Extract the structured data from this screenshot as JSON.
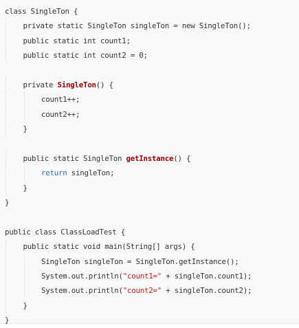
{
  "code_block": {
    "language": "java",
    "colors": {
      "background": "#f6f8fa",
      "text": "#333333",
      "method_name": "#990000",
      "keyword_return": "#2a6fc9",
      "string": "#c41a16"
    },
    "lines": [
      {
        "indent": 0,
        "tokens": [
          {
            "t": "class SingleTon {",
            "k": "plain"
          }
        ]
      },
      {
        "indent": 1,
        "tokens": [
          {
            "t": "private static SingleTon singleTon = new SingleTon();",
            "k": "plain"
          }
        ]
      },
      {
        "indent": 1,
        "tokens": [
          {
            "t": "public static int count1;",
            "k": "plain"
          }
        ]
      },
      {
        "indent": 1,
        "tokens": [
          {
            "t": "public static int count2 = 0;",
            "k": "plain"
          }
        ]
      },
      {
        "indent": 0,
        "tokens": []
      },
      {
        "indent": 1,
        "tokens": [
          {
            "t": "private ",
            "k": "plain"
          },
          {
            "t": "SingleTon",
            "k": "fn"
          },
          {
            "t": "() {",
            "k": "plain"
          }
        ]
      },
      {
        "indent": 2,
        "tokens": [
          {
            "t": "count1++;",
            "k": "plain"
          }
        ]
      },
      {
        "indent": 2,
        "tokens": [
          {
            "t": "count2++;",
            "k": "plain"
          }
        ]
      },
      {
        "indent": 1,
        "tokens": [
          {
            "t": "}",
            "k": "plain"
          }
        ]
      },
      {
        "indent": 0,
        "tokens": []
      },
      {
        "indent": 1,
        "tokens": [
          {
            "t": "public static SingleTon ",
            "k": "plain"
          },
          {
            "t": "getInstance",
            "k": "fn"
          },
          {
            "t": "() {",
            "k": "plain"
          }
        ]
      },
      {
        "indent": 2,
        "tokens": [
          {
            "t": "return",
            "k": "kw"
          },
          {
            "t": " singleTon;",
            "k": "plain"
          }
        ]
      },
      {
        "indent": 1,
        "tokens": [
          {
            "t": "}",
            "k": "plain"
          }
        ]
      },
      {
        "indent": 0,
        "tokens": [
          {
            "t": "}",
            "k": "plain"
          }
        ]
      },
      {
        "indent": 0,
        "tokens": []
      },
      {
        "indent": 0,
        "tokens": [
          {
            "t": "public class ClassLoadTest {",
            "k": "plain"
          }
        ]
      },
      {
        "indent": 1,
        "tokens": [
          {
            "t": "public static void main(String[] args) {",
            "k": "plain"
          }
        ]
      },
      {
        "indent": 2,
        "tokens": [
          {
            "t": "SingleTon singleTon = SingleTon.getInstance();",
            "k": "plain"
          }
        ]
      },
      {
        "indent": 2,
        "tokens": [
          {
            "t": "System.out.println(",
            "k": "plain"
          },
          {
            "t": "\"count1=\"",
            "k": "str"
          },
          {
            "t": " + singleTon.count1);",
            "k": "plain"
          }
        ]
      },
      {
        "indent": 2,
        "tokens": [
          {
            "t": "System.out.println(",
            "k": "plain"
          },
          {
            "t": "\"count2=\"",
            "k": "str"
          },
          {
            "t": " + singleTon.count2);",
            "k": "plain"
          }
        ]
      },
      {
        "indent": 1,
        "tokens": [
          {
            "t": "}",
            "k": "plain"
          }
        ]
      },
      {
        "indent": 0,
        "tokens": [
          {
            "t": "}",
            "k": "plain"
          }
        ]
      }
    ]
  }
}
